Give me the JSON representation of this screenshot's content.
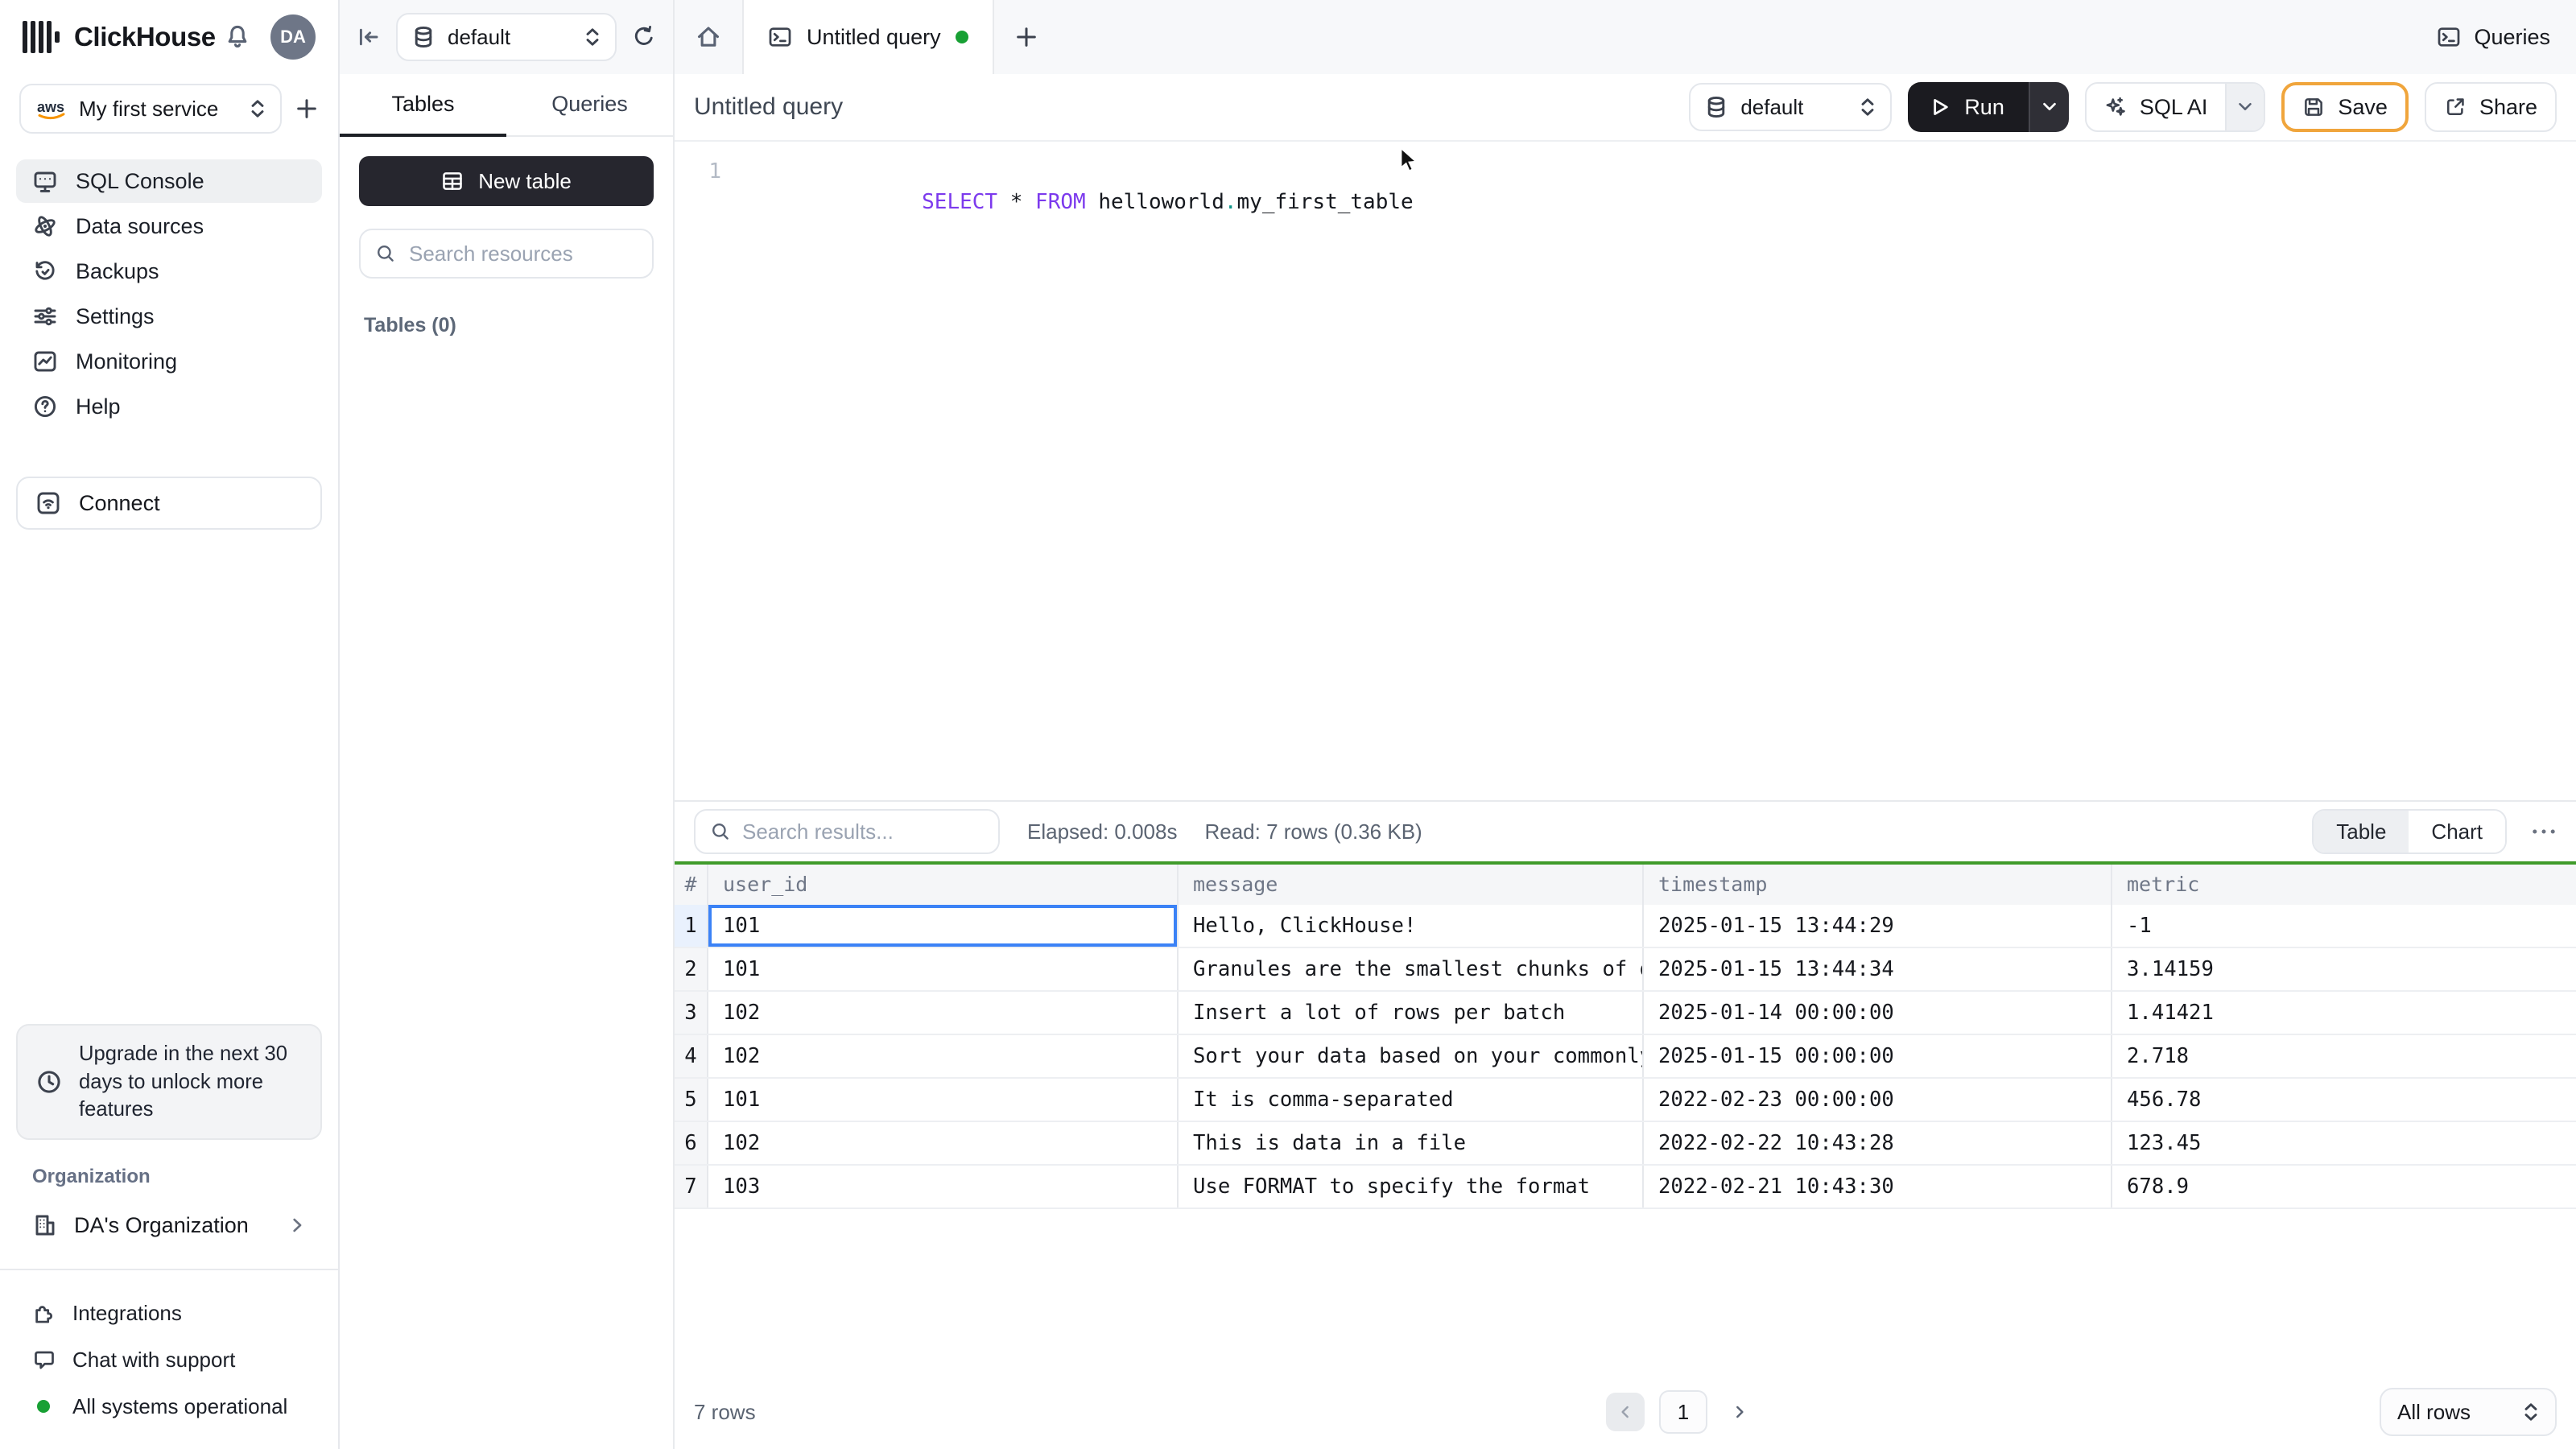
{
  "header": {
    "logo_text": "ClickHouse",
    "avatar_initials": "DA"
  },
  "topbar": {
    "database_selector": "default",
    "tab_label": "Untitled query",
    "queries_button": "Queries"
  },
  "sidebar": {
    "service_selector": "My first service",
    "nav": [
      {
        "label": "SQL Console",
        "icon": "console-monitor-icon",
        "active": true
      },
      {
        "label": "Data sources",
        "icon": "orbit-icon"
      },
      {
        "label": "Backups",
        "icon": "history-icon"
      },
      {
        "label": "Settings",
        "icon": "sliders-icon"
      },
      {
        "label": "Monitoring",
        "icon": "chart-icon"
      },
      {
        "label": "Help",
        "icon": "help-icon"
      }
    ],
    "connect_label": "Connect",
    "upgrade_notice": "Upgrade in the next 30 days to unlock more features",
    "organization_section_label": "Organization",
    "organization_name": "DA's Organization",
    "links": [
      {
        "label": "Integrations",
        "icon": "puzzle-icon"
      },
      {
        "label": "Chat with support",
        "icon": "chat-bubble-icon"
      },
      {
        "label": "All systems operational",
        "icon": "green-status-dot"
      }
    ]
  },
  "explorer": {
    "tabs": [
      "Tables",
      "Queries"
    ],
    "new_table_button": "New table",
    "search_placeholder": "Search resources",
    "tables_count_label": "Tables (0)"
  },
  "query": {
    "title": "Untitled query",
    "database_selector": "default",
    "run_button": "Run",
    "sql_ai_button": "SQL AI",
    "save_button": "Save",
    "share_button": "Share",
    "editor": {
      "line_number": "1",
      "sql": {
        "kw_select": "SELECT",
        "star": " * ",
        "kw_from": "FROM",
        "schema": " helloworld",
        "dot": ".",
        "table": "my_first_table"
      }
    }
  },
  "results": {
    "search_placeholder": "Search results...",
    "elapsed": "Elapsed: 0.008s",
    "read": "Read: 7 rows (0.36 KB)",
    "view_toggle": [
      "Table",
      "Chart"
    ],
    "columns": [
      "#",
      "user_id",
      "message",
      "timestamp",
      "metric"
    ],
    "selected_cell": {
      "row": 0,
      "column": "user_id"
    },
    "rows": [
      {
        "num": "1",
        "user_id": "101",
        "message": "Hello, ClickHouse!",
        "timestamp": "2025-01-15 13:44:29",
        "metric": "-1"
      },
      {
        "num": "2",
        "user_id": "101",
        "message": "Granules are the smallest chunks of data read",
        "timestamp": "2025-01-15 13:44:34",
        "metric": "3.14159"
      },
      {
        "num": "3",
        "user_id": "102",
        "message": "Insert a lot of rows per batch",
        "timestamp": "2025-01-14 00:00:00",
        "metric": "1.41421"
      },
      {
        "num": "4",
        "user_id": "102",
        "message": "Sort your data based on your commonly-used que…",
        "timestamp": "2025-01-15 00:00:00",
        "metric": "2.718"
      },
      {
        "num": "5",
        "user_id": "101",
        "message": "It is comma-separated",
        "timestamp": "2022-02-23 00:00:00",
        "metric": "456.78"
      },
      {
        "num": "6",
        "user_id": "102",
        "message": "This is data in a file",
        "timestamp": "2022-02-22 10:43:28",
        "metric": "123.45"
      },
      {
        "num": "7",
        "user_id": "103",
        "message": "Use FORMAT to specify the format",
        "timestamp": "2022-02-21 10:43:30",
        "metric": "678.9"
      }
    ],
    "footer": {
      "row_count": "7 rows",
      "page": "1",
      "page_size": "All rows"
    }
  },
  "colors": {
    "accent_green": "#3f9b2a",
    "status_green": "#18a034",
    "selected_cell_blue": "#3b82f6",
    "save_outline_amber": "#f0a53c",
    "sql_keyword_purple": "#7c3aed",
    "sql_punct_teal": "#0d9488",
    "dark_button": "#1b1b20"
  }
}
